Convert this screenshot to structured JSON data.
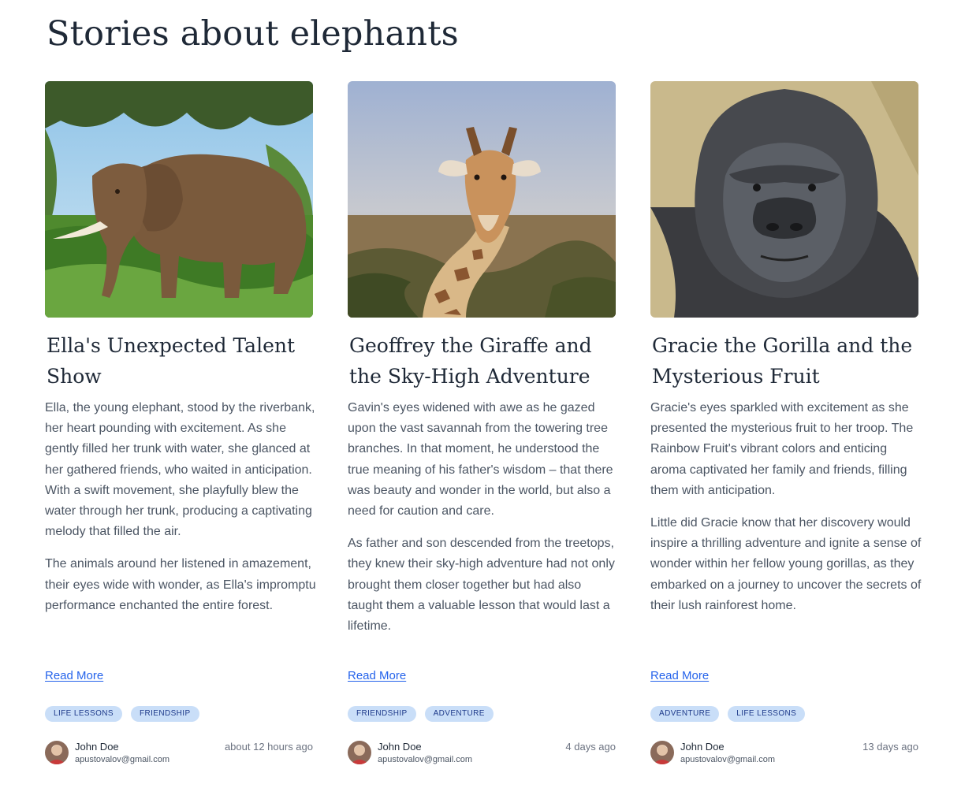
{
  "page": {
    "title": "Stories about elephants"
  },
  "cards": [
    {
      "title": "Ella's Unexpected Talent Show",
      "paragraphs": [
        "Ella, the young elephant, stood by the riverbank, her heart pounding with excitement. As she gently filled her trunk with water, she glanced at her gathered friends, who waited in anticipation. With a swift movement, she playfully blew the water through her trunk, producing a captivating melody that filled the air.",
        "The animals around her listened in amazement, their eyes wide with wonder, as Ella's impromptu performance enchanted the entire forest."
      ],
      "read_more": "Read More",
      "tags": [
        "LIFE LESSONS",
        "FRIENDSHIP"
      ],
      "author": {
        "name": "John Doe",
        "email": "apustovalov@gmail.com"
      },
      "time": "about 12 hours ago",
      "image": "elephant-photo"
    },
    {
      "title": "Geoffrey the Giraffe and the Sky-High Adventure",
      "paragraphs": [
        "Gavin's eyes widened with awe as he gazed upon the vast savannah from the towering tree branches. In that moment, he understood the true meaning of his father's wisdom – that there was beauty and wonder in the world, but also a need for caution and care.",
        "As father and son descended from the treetops, they knew their sky-high adventure had not only brought them closer together but had also taught them a valuable lesson that would last a lifetime."
      ],
      "read_more": "Read More",
      "tags": [
        "FRIENDSHIP",
        "ADVENTURE"
      ],
      "author": {
        "name": "John Doe",
        "email": "apustovalov@gmail.com"
      },
      "time": "4 days ago",
      "image": "giraffe-photo"
    },
    {
      "title": "Gracie the Gorilla and the Mysterious Fruit",
      "paragraphs": [
        "Gracie's eyes sparkled with excitement as she presented the mysterious fruit to her troop. The Rainbow Fruit's vibrant colors and enticing aroma captivated her family and friends, filling them with anticipation.",
        "Little did Gracie know that her discovery would inspire a thrilling adventure and ignite a sense of wonder within her fellow young gorillas, as they embarked on a journey to uncover the secrets of their lush rainforest home."
      ],
      "read_more": "Read More",
      "tags": [
        "ADVENTURE",
        "LIFE LESSONS"
      ],
      "author": {
        "name": "John Doe",
        "email": "apustovalov@gmail.com"
      },
      "time": "13 days ago",
      "image": "gorilla-photo"
    }
  ]
}
